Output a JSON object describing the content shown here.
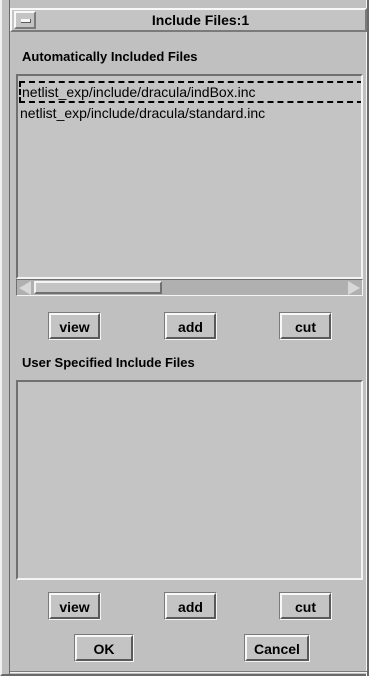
{
  "window": {
    "title": "Include Files:1"
  },
  "auto_section": {
    "label": "Automatically Included Files",
    "files": [
      "netlist_exp/include/dracula/indBox.inc",
      "netlist_exp/include/dracula/standard.inc"
    ],
    "buttons": {
      "view": "view",
      "add": "add",
      "cut": "cut"
    }
  },
  "user_section": {
    "label": "User Specified Include Files",
    "files": [],
    "buttons": {
      "view": "view",
      "add": "add",
      "cut": "cut"
    }
  },
  "dialog_buttons": {
    "ok": "OK",
    "cancel": "Cancel"
  }
}
